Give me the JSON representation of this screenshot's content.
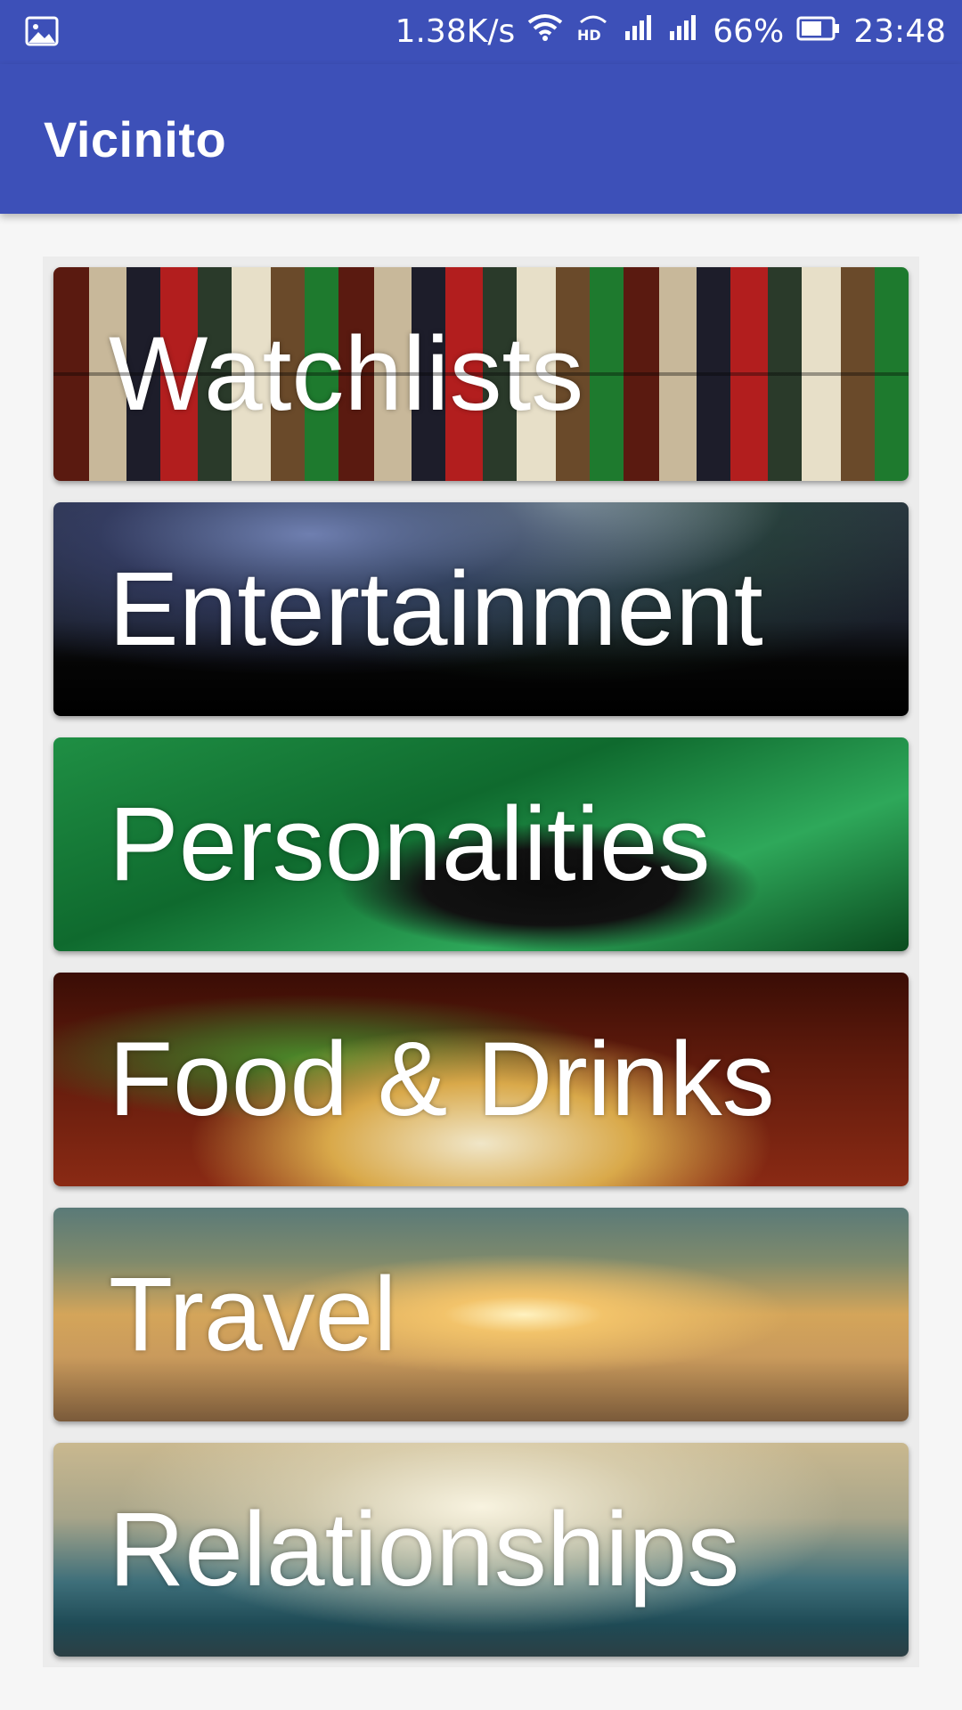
{
  "status_bar": {
    "network_speed": "1.38K/s",
    "battery_percent": "66%",
    "time": "23:48",
    "icons": [
      "gallery-icon",
      "wifi-icon",
      "hd-call-icon",
      "signal-icon",
      "signal-icon",
      "battery-icon"
    ]
  },
  "app_bar": {
    "title": "Vicinito"
  },
  "categories": [
    {
      "label": "Watchlists"
    },
    {
      "label": "Entertainment"
    },
    {
      "label": "Personalities"
    },
    {
      "label": "Food & Drinks"
    },
    {
      "label": "Travel"
    },
    {
      "label": "Relationships"
    }
  ],
  "colors": {
    "primary": "#3d50b8",
    "background": "#f6f6f6",
    "card_text": "#ffffff"
  }
}
